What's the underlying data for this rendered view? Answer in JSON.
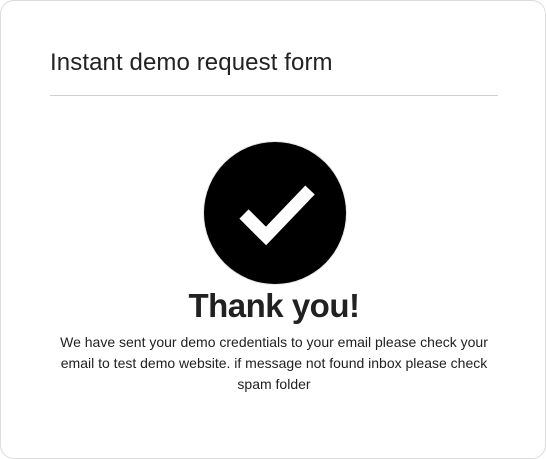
{
  "form": {
    "title": "Instant demo request form"
  },
  "success": {
    "icon": "checkmark-icon",
    "heading": "Thank you!",
    "message": "We have sent your demo credentials to your email please check your email to test demo website. if message not found inbox please check spam folder"
  },
  "colors": {
    "circle": "#000000",
    "check": "#ffffff",
    "text": "#212121",
    "border": "#dcdcdc"
  }
}
